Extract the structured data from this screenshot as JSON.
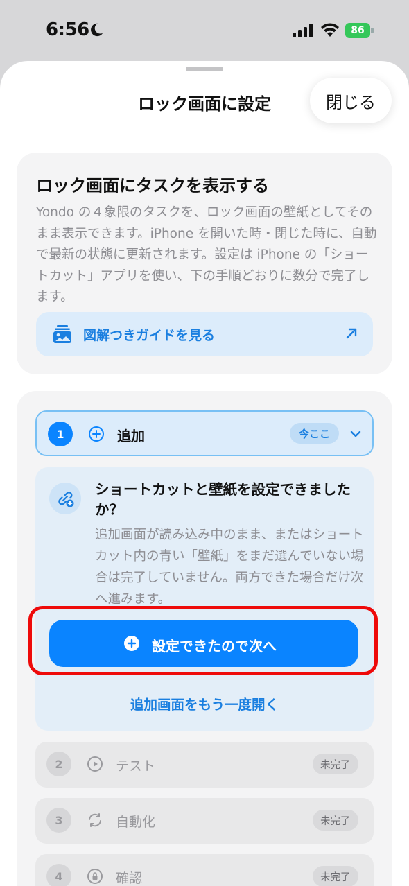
{
  "status_bar": {
    "time": "6:56",
    "battery": "86"
  },
  "sheet": {
    "title": "ロック画面に設定",
    "close_label": "閉じる"
  },
  "intro": {
    "title": "ロック画面にタスクを表示する",
    "body": "Yondo の４象限のタスクを、ロック画面の壁紙としてそのまま表示できます。iPhone を開いた時・閉じた時に、自動で最新の状態に更新されます。設定は iPhone の「ショートカット」アプリを使い、下の手順どおりに数分で完了します。",
    "guide_label": "図解つきガイドを見る"
  },
  "steps": {
    "active": {
      "number": "1",
      "label": "追加",
      "badge": "今ここ"
    },
    "detail": {
      "title": "ショートカットと壁紙を設定できましたか？",
      "body": "追加画面が読み込み中のまま、またはショートカット内の青い「壁紙」をまだ選んでいない場合は完了していません。両方できた場合だけ次へ進みます。",
      "primary_label": "設定できたので次へ",
      "link_label": "追加画面をもう一度開く"
    },
    "items": [
      {
        "number": "2",
        "label": "テスト",
        "badge": "未完了",
        "icon": "play-circle-icon"
      },
      {
        "number": "3",
        "label": "自動化",
        "badge": "未完了",
        "icon": "refresh-icon"
      },
      {
        "number": "4",
        "label": "確認",
        "badge": "未完了",
        "icon": "lock-icon"
      }
    ]
  },
  "colors": {
    "accent": "#0a84ff",
    "link": "#1a7fe0",
    "highlight": "#ee0a0a"
  }
}
